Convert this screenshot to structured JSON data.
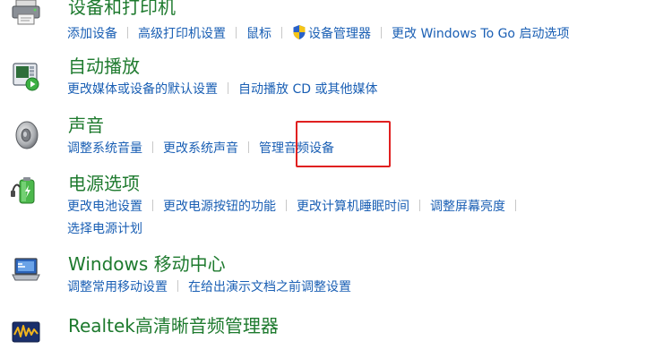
{
  "devices_printers": {
    "title": "设备和打印机",
    "icon": "printer-icon",
    "links": [
      {
        "label": "添加设备"
      },
      {
        "label": "高级打印机设置"
      },
      {
        "label": "鼠标"
      },
      {
        "label": "设备管理器",
        "icon": "shield-icon"
      },
      {
        "label": "更改 Windows To Go 启动选项"
      }
    ]
  },
  "autoplay": {
    "title": "自动播放",
    "icon": "autoplay-icon",
    "links": [
      {
        "label": "更改媒体或设备的默认设置"
      },
      {
        "label": "自动播放 CD 或其他媒体"
      }
    ]
  },
  "sound": {
    "title": "声音",
    "icon": "speaker-icon",
    "links": [
      {
        "label": "调整系统音量"
      },
      {
        "label": "更改系统声音"
      },
      {
        "label": "管理音频设备"
      }
    ]
  },
  "power": {
    "title": "电源选项",
    "icon": "battery-icon",
    "links": [
      {
        "label": "更改电池设置"
      },
      {
        "label": "更改电源按钮的功能"
      },
      {
        "label": "更改计算机睡眠时间"
      },
      {
        "label": "调整屏幕亮度"
      }
    ],
    "links_row2": [
      {
        "label": "选择电源计划"
      }
    ]
  },
  "mobility": {
    "title": "Windows 移动中心",
    "icon": "laptop-icon",
    "links": [
      {
        "label": "调整常用移动设置"
      },
      {
        "label": "在给出演示文档之前调整设置"
      }
    ]
  },
  "realtek": {
    "title": "Realtek高清晰音频管理器",
    "icon": "realtek-audio-icon"
  },
  "colors": {
    "title": "#1e7a2e",
    "link": "#1a5fb4",
    "highlight": "#e02020"
  }
}
